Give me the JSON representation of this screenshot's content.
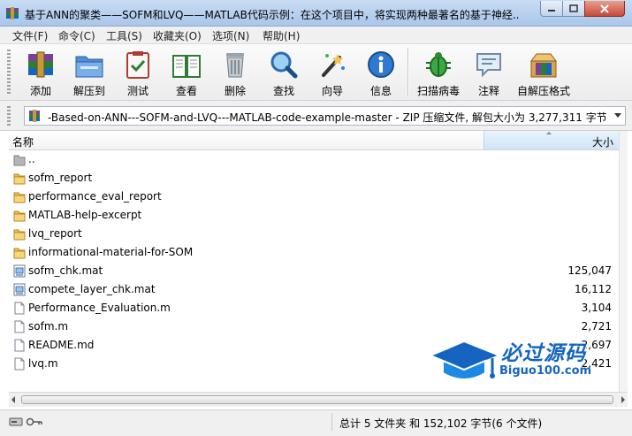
{
  "window": {
    "title": "基于ANN的聚类——SOFM和LVQ——MATLAB代码示例：在这个项目中，将实现两种最著名的基于神经..."
  },
  "menu": [
    "文件(F)",
    "命令(C)",
    "工具(S)",
    "收藏夹(O)",
    "选项(N)",
    "帮助(H)"
  ],
  "toolbar": {
    "add": "添加",
    "extract": "解压到",
    "test": "测试",
    "view": "查看",
    "delete": "删除",
    "find": "查找",
    "wizard": "向导",
    "info": "信息",
    "scan": "扫描病毒",
    "comment": "注释",
    "sfx": "自解压格式"
  },
  "address": {
    "path": "-Based-on-ANN---SOFM-and-LVQ---MATLAB-code-example-master - ZIP 压缩文件, 解包大小为 3,277,311 字节"
  },
  "columns": {
    "name": "名称",
    "size": "大小"
  },
  "files": [
    {
      "name": "..",
      "size": "",
      "icon": "folder-up-icon"
    },
    {
      "name": "sofm_report",
      "size": "",
      "icon": "folder-icon"
    },
    {
      "name": "performance_eval_report",
      "size": "",
      "icon": "folder-icon"
    },
    {
      "name": "MATLAB-help-excerpt",
      "size": "",
      "icon": "folder-icon"
    },
    {
      "name": "lvq_report",
      "size": "",
      "icon": "folder-icon"
    },
    {
      "name": "informational-material-for-SOM",
      "size": "",
      "icon": "folder-icon"
    },
    {
      "name": "sofm_chk.mat",
      "size": "125,047",
      "icon": "mat-file-icon"
    },
    {
      "name": "compete_layer_chk.mat",
      "size": "16,112",
      "icon": "mat-file-icon"
    },
    {
      "name": "Performance_Evaluation.m",
      "size": "3,104",
      "icon": "file-icon"
    },
    {
      "name": "sofm.m",
      "size": "2,721",
      "icon": "file-icon"
    },
    {
      "name": "README.md",
      "size": "2,697",
      "icon": "file-icon"
    },
    {
      "name": "lvq.m",
      "size": "2,421",
      "icon": "file-icon"
    }
  ],
  "status": {
    "summary": "总计 5 文件夹 和 152,102 字节(6 个文件)"
  },
  "watermark": {
    "title": "必过源码",
    "url": "Biguo100.com"
  },
  "colors": {
    "accent": "#1565c0",
    "folder": "#f2c14e",
    "title_gradient_top": "#c9dcf3"
  }
}
